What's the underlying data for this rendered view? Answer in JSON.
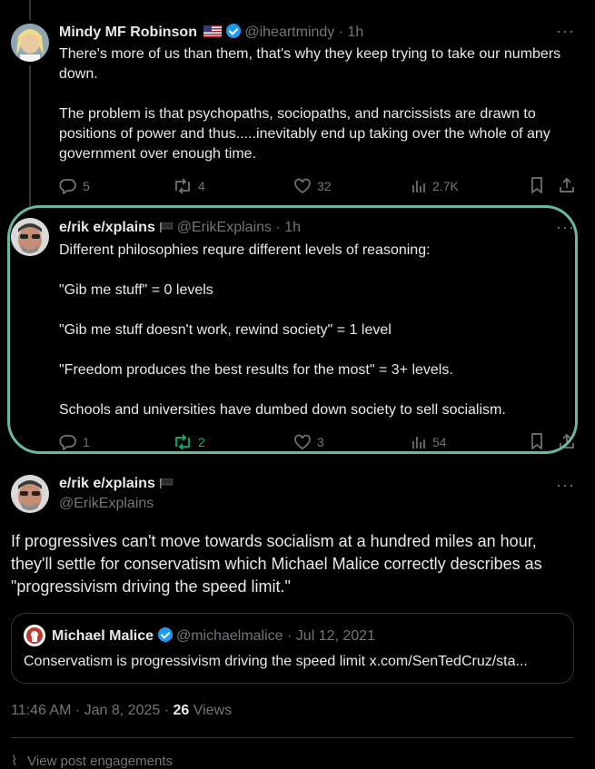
{
  "tweet1": {
    "name": "Mindy MF Robinson",
    "flag": "🇺🇸",
    "handle": "@iheartmindy",
    "time": "· 1h",
    "text": "There's more of us than them, that's why they keep trying to take our numbers down.\n\nThe problem is that psychopaths, sociopaths, and narcissists are drawn to positions of power and thus.....inevitably end up taking over the whole of any government over enough time.",
    "replies": "5",
    "reposts": "4",
    "likes": "32",
    "views": "2.7K"
  },
  "tweet2": {
    "name": "e/rik e/xplains",
    "handle": "@ErikExplains",
    "time": "· 1h",
    "text": "Different philosophies requre different levels of reasoning:\n\n\"Gib me stuff\" = 0 levels\n\n\"Gib me stuff doesn't work, rewind society\" = 1 level\n\n\"Freedom produces the best results for the most\" = 3+ levels.\n\nSchools and universities have dumbed down society to sell socialism.",
    "replies": "1",
    "reposts": "2",
    "likes": "3",
    "views": "54"
  },
  "tweet3": {
    "name": "e/rik e/xplains",
    "handle": "@ErikExplains",
    "text": "If progressives can't move towards socialism at a hundred miles an hour, they'll settle for conservatism which Michael Malice correctly describes as \"progressivism driving the speed limit.\"",
    "quote": {
      "name": "Michael Malice",
      "handle": "@michaelmalice",
      "date": "· Jul 12, 2021",
      "text": "Conservatism is progressivism driving the speed limit x.com/SenTedCruz/sta..."
    },
    "timestamp": "11:46 AM · Jan 8, 2025 · ",
    "views_count": "26",
    "views_label": " Views",
    "engagements": "View post engagements"
  },
  "colors": {
    "highlight": "#6ab7a4",
    "repost_active": "#00ba7c",
    "verified": "#1d9bf0"
  }
}
